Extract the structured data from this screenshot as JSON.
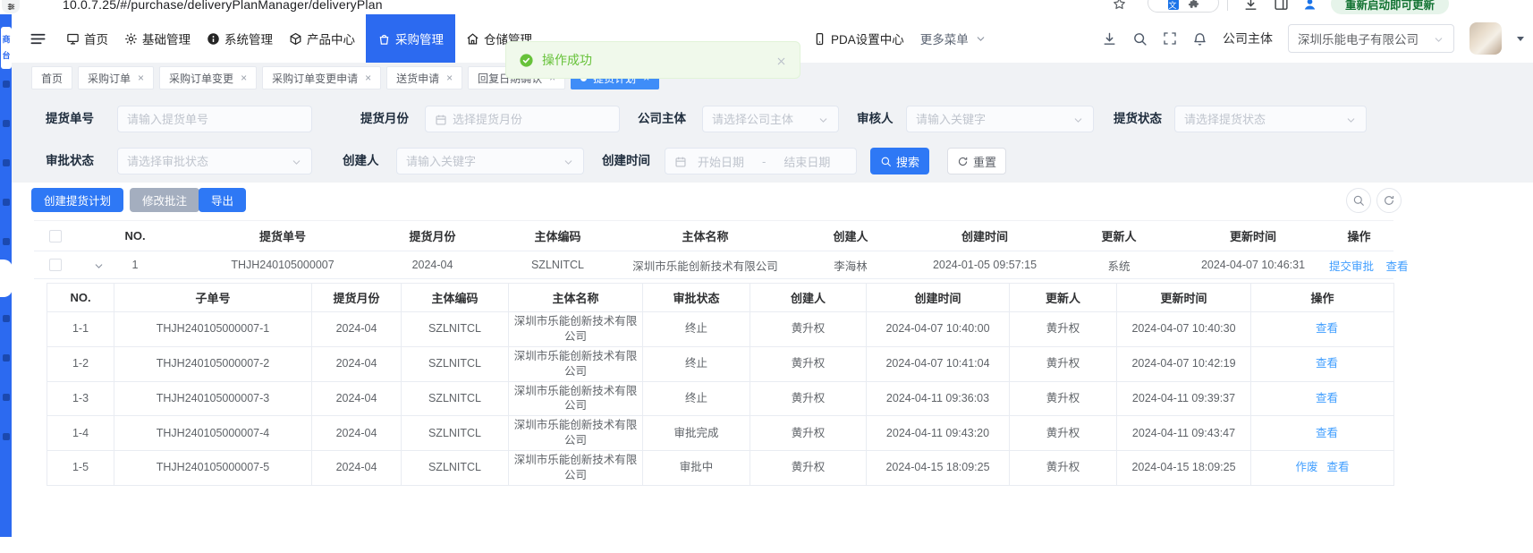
{
  "browser": {
    "url": "10.0.7.25/#/purchase/deliveryPlanManager/deliveryPlan",
    "update_chip": "重新启动即可更新"
  },
  "rail": {
    "logo_top": "商",
    "logo_bottom": "台"
  },
  "nav": {
    "items": [
      {
        "label": "首页"
      },
      {
        "label": "基础管理"
      },
      {
        "label": "系统管理"
      },
      {
        "label": "产品中心"
      },
      {
        "label": "采购管理"
      },
      {
        "label": "仓储管理"
      },
      {
        "label": "PDA设置中心"
      },
      {
        "label": "更多菜单"
      }
    ],
    "company_label": "公司主体",
    "company_value": "深圳乐能电子有限公司"
  },
  "toast": {
    "message": "操作成功"
  },
  "tabs": [
    {
      "label": "首页"
    },
    {
      "label": "采购订单"
    },
    {
      "label": "采购订单变更"
    },
    {
      "label": "采购订单变更申请"
    },
    {
      "label": "送货申请"
    },
    {
      "label": "回复日期确认"
    },
    {
      "label": "提货计划"
    }
  ],
  "filters": {
    "f1": {
      "label": "提货单号",
      "placeholder": "请输入提货单号"
    },
    "f2": {
      "label": "提货月份",
      "placeholder": "选择提货月份"
    },
    "f3": {
      "label": "公司主体",
      "placeholder": "请选择公司主体"
    },
    "f4": {
      "label": "审核人",
      "placeholder": "请输入关键字"
    },
    "f5": {
      "label": "提货状态",
      "placeholder": "请选择提货状态"
    },
    "f6": {
      "label": "审批状态",
      "placeholder": "请选择审批状态"
    },
    "f7": {
      "label": "创建人",
      "placeholder": "请输入关键字"
    },
    "f8": {
      "label": "创建时间",
      "start": "开始日期",
      "separator": "-",
      "end": "结束日期"
    },
    "search": "搜索",
    "reset": "重置"
  },
  "toolbar": {
    "create": "创建提货计划",
    "edit_note": "修改批注",
    "export": "导出"
  },
  "table": {
    "headers": {
      "no": "NO.",
      "order": "提货单号",
      "month": "提货月份",
      "code": "主体编码",
      "name": "主体名称",
      "creator": "创建人",
      "created": "创建时间",
      "updater": "更新人",
      "updated": "更新时间",
      "ops": "操作"
    },
    "row": {
      "no": "1",
      "order": "THJH240105000007",
      "month": "2024-04",
      "code": "SZLNITCL",
      "name": "深圳市乐能创新技术有限公司",
      "creator": "李海林",
      "created": "2024-01-05 09:57:15",
      "updater": "系统",
      "updated": "2024-04-07 10:46:31",
      "op1": "提交审批",
      "op2": "查看"
    }
  },
  "subtable": {
    "headers": {
      "no": "NO.",
      "order": "子单号",
      "month": "提货月份",
      "code": "主体编码",
      "name": "主体名称",
      "status": "审批状态",
      "creator": "创建人",
      "created": "创建时间",
      "updater": "更新人",
      "updated": "更新时间",
      "ops": "操作"
    },
    "rows": [
      {
        "no": "1-1",
        "order": "THJH240105000007-1",
        "month": "2024-04",
        "code": "SZLNITCL",
        "name": "深圳市乐能创新技术有限公司",
        "status": "终止",
        "creator": "黄升权",
        "created": "2024-04-07 10:40:00",
        "updater": "黄升权",
        "updated": "2024-04-07 10:40:30",
        "op2": "查看"
      },
      {
        "no": "1-2",
        "order": "THJH240105000007-2",
        "month": "2024-04",
        "code": "SZLNITCL",
        "name": "深圳市乐能创新技术有限公司",
        "status": "终止",
        "creator": "黄升权",
        "created": "2024-04-07 10:41:04",
        "updater": "黄升权",
        "updated": "2024-04-07 10:42:19",
        "op2": "查看"
      },
      {
        "no": "1-3",
        "order": "THJH240105000007-3",
        "month": "2024-04",
        "code": "SZLNITCL",
        "name": "深圳市乐能创新技术有限公司",
        "status": "终止",
        "creator": "黄升权",
        "created": "2024-04-11 09:36:03",
        "updater": "黄升权",
        "updated": "2024-04-11 09:39:37",
        "op2": "查看"
      },
      {
        "no": "1-4",
        "order": "THJH240105000007-4",
        "month": "2024-04",
        "code": "SZLNITCL",
        "name": "深圳市乐能创新技术有限公司",
        "status": "审批完成",
        "creator": "黄升权",
        "created": "2024-04-11 09:43:20",
        "updater": "黄升权",
        "updated": "2024-04-11 09:43:47",
        "op2": "查看"
      },
      {
        "no": "1-5",
        "order": "THJH240105000007-5",
        "month": "2024-04",
        "code": "SZLNITCL",
        "name": "深圳市乐能创新技术有限公司",
        "status": "审批中",
        "creator": "黄升权",
        "created": "2024-04-15 18:09:25",
        "updater": "黄升权",
        "updated": "2024-04-15 18:09:25",
        "op1": "作废",
        "op2": "查看"
      }
    ]
  },
  "colors": {
    "accent": "#2c6af0",
    "tab_active": "#3f8df8",
    "link": "#409eff",
    "success": "#67c23a",
    "gray_button": "#a4aebf"
  }
}
